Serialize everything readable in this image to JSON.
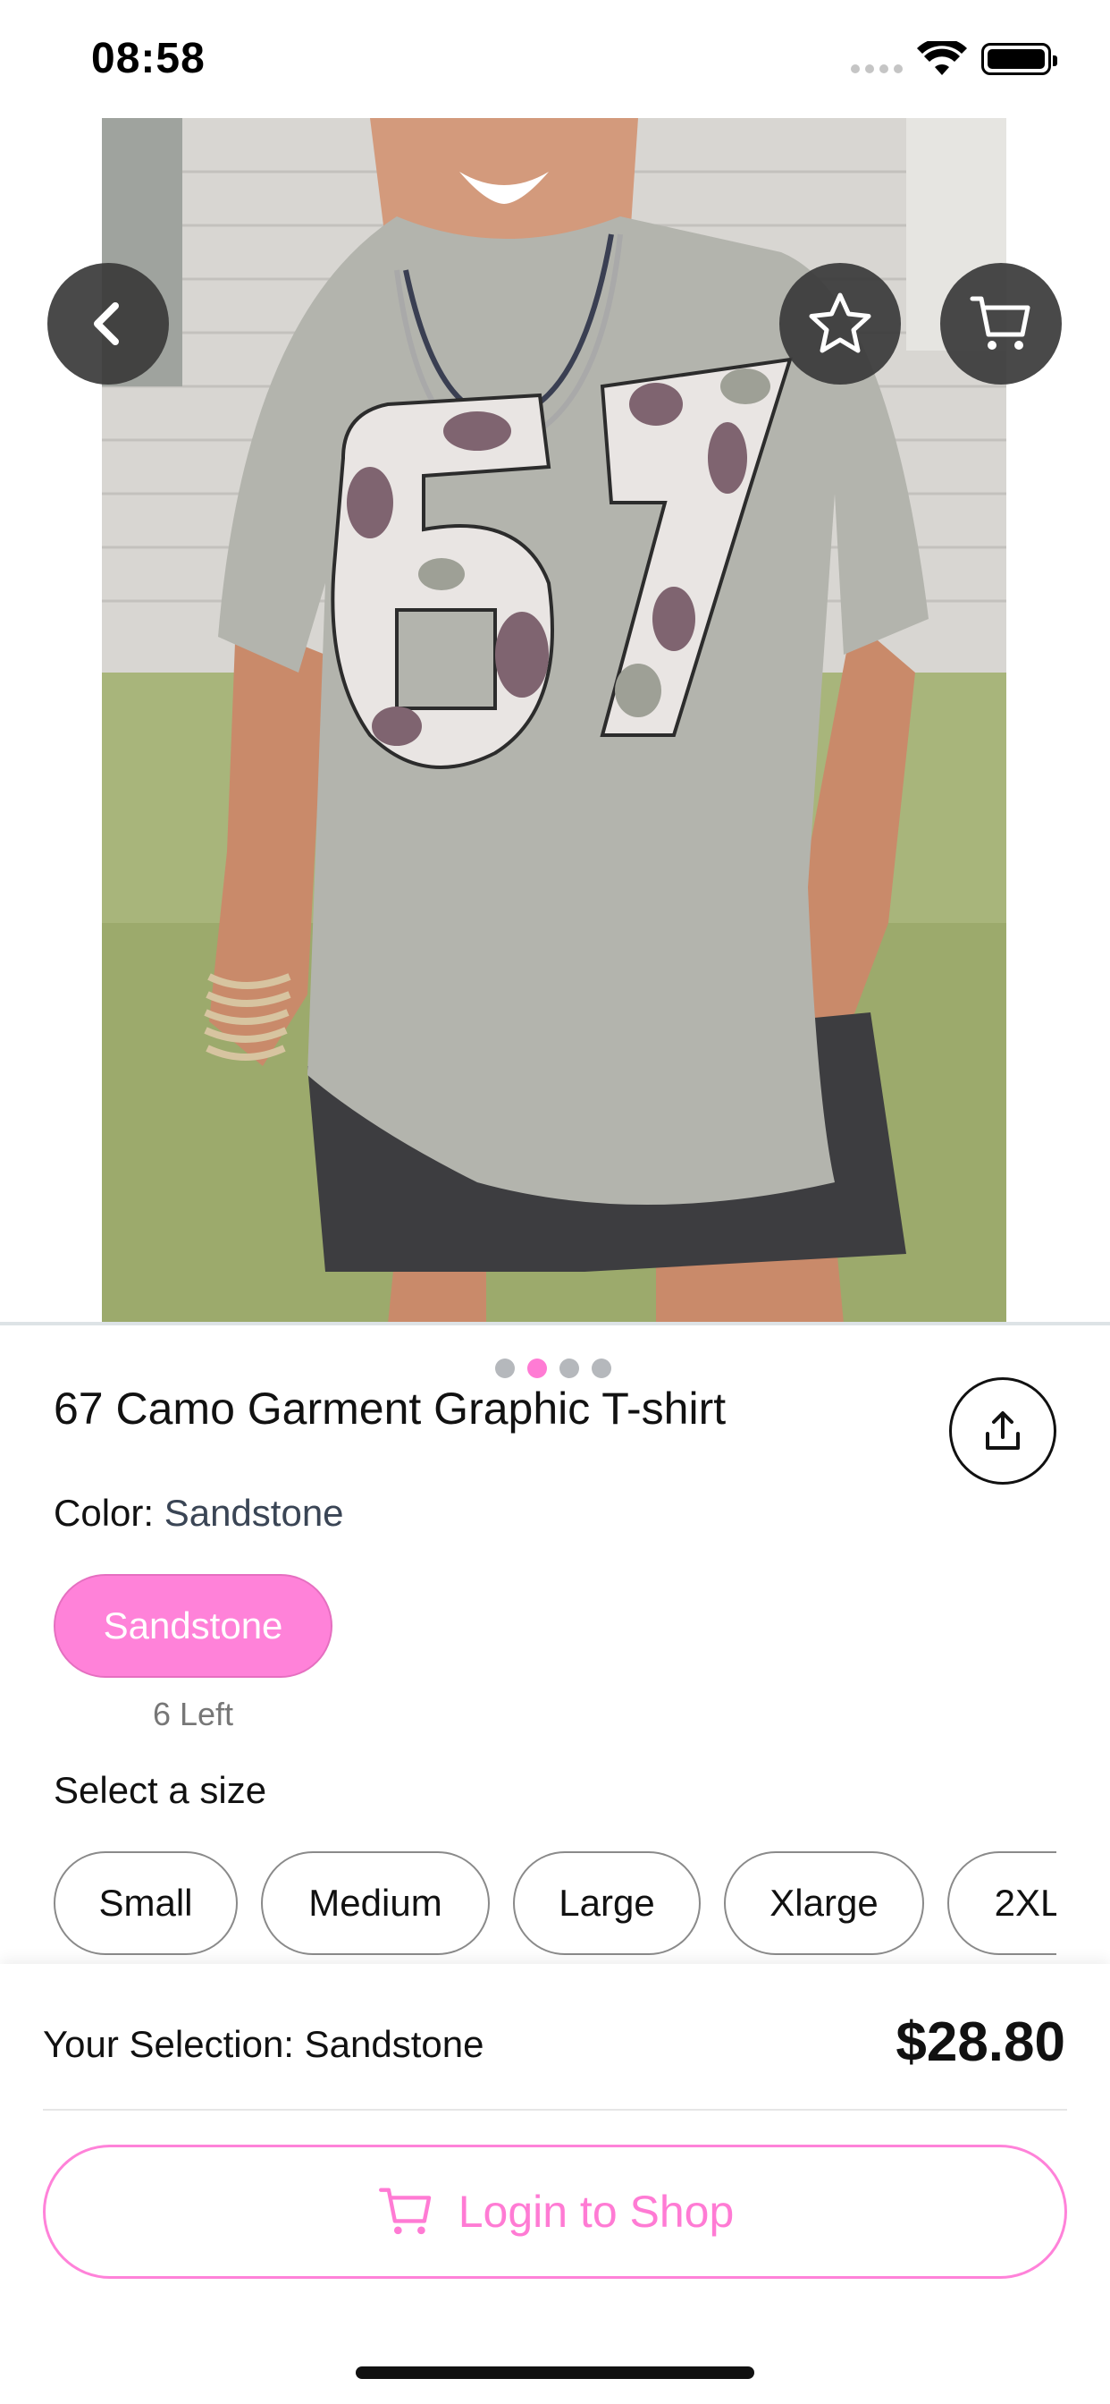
{
  "status_bar": {
    "time": "08:58",
    "icons": [
      "signal-icon",
      "wifi-icon",
      "battery-icon"
    ]
  },
  "header": {
    "back_icon": "chevron-left-icon",
    "favorite_icon": "star-icon",
    "cart_icon": "cart-icon"
  },
  "gallery": {
    "image_count": 4,
    "active_index": 1,
    "active_dot_color": "#ff7bd4"
  },
  "product": {
    "title": "67 Camo Garment Graphic T-shirt",
    "share_icon": "share-icon",
    "color_label": "Color: ",
    "color_value": "Sandstone",
    "colors": [
      {
        "label": "Sandstone",
        "stock": "6 Left",
        "selected": true
      }
    ],
    "size_label": "Select a size",
    "sizes": [
      "Small",
      "Medium",
      "Large",
      "Xlarge",
      "2XL"
    ]
  },
  "footer": {
    "selection_text": "Your Selection: Sandstone",
    "price": "$28.80",
    "login_button": "Login to Shop",
    "accent_color": "#ff82d9"
  }
}
